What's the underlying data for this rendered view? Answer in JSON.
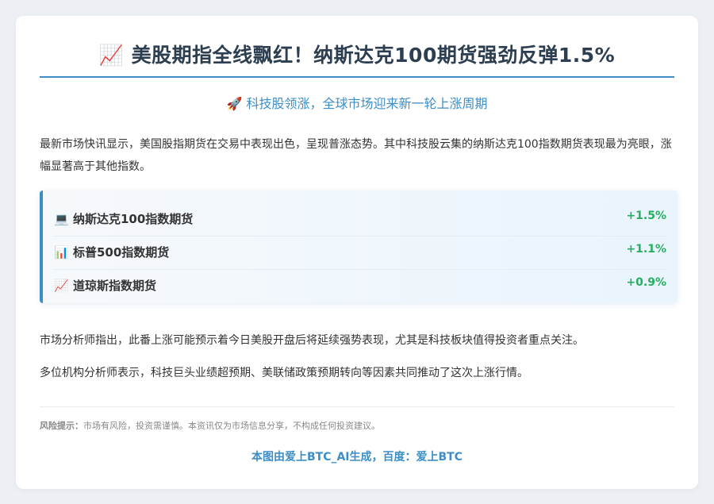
{
  "article": {
    "title_icon": "📈",
    "title": "美股期指全线飘红！纳斯达克100期货强劲反弹1.5%",
    "subtitle_icon": "🚀",
    "subtitle": "科技股领涨，全球市场迎来新一轮上涨周期",
    "intro": "最新市场快讯显示，美国股指期货在交易中表现出色，呈现普涨态势。其中科技股云集的纳斯达克100指数期货表现最为亮眼，涨幅显著高于其他指数。",
    "futures": [
      {
        "icon": "💻",
        "icon_name": "laptop-icon",
        "name": "纳斯达克100指数期货",
        "change": "+1.5%"
      },
      {
        "icon": "📊",
        "icon_name": "bar-chart-icon",
        "name": "标普500指数期货",
        "change": "+1.1%"
      },
      {
        "icon": "📈",
        "icon_name": "trend-up-icon",
        "name": "道琼斯指数期货",
        "change": "+0.9%"
      }
    ],
    "analysis_1": "市场分析师指出，此番上涨可能预示着今日美股开盘后将延续强势表现，尤其是科技板块值得投资者重点关注。",
    "analysis_2": "多位机构分析师表示，科技巨头业绩超预期、美联储政策预期转向等因素共同推动了这次上涨行情。",
    "risk_label": "风险提示：",
    "risk_text": "市场有风险，投资需谨慎。本资讯仅为市场信息分享，不构成任何投资建议。",
    "footer": "本图由爱上BTC_AI生成，百度：爱上BTC"
  },
  "colors": {
    "accent": "#3d8ec7",
    "positive": "#27ae60",
    "title": "#2c3e50",
    "background": "#eceff3"
  }
}
